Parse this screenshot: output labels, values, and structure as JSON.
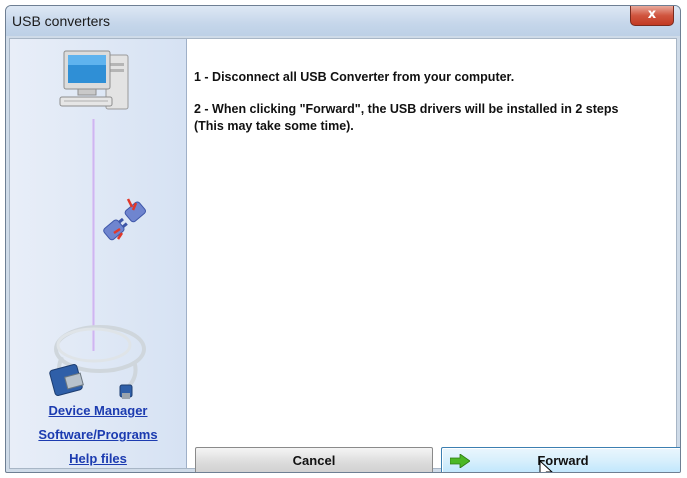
{
  "window": {
    "title": "USB converters",
    "close_symbol": "x"
  },
  "instructions": {
    "step1": "1 - Disconnect all USB Converter from your computer.",
    "step2_line1": "2 - When clicking \"Forward\", the USB drivers will be installed in 2 steps",
    "step2_line2": "(This may take some time)."
  },
  "sidebar": {
    "links": {
      "device_manager": "Device Manager",
      "software_programs": "Software/Programs",
      "help_files": "Help files"
    },
    "icons": [
      "computer-icon",
      "disconnected-plug-icon",
      "usb-serial-cable-icon"
    ]
  },
  "buttons": {
    "cancel": "Cancel",
    "forward": "Forward"
  },
  "colors": {
    "link": "#1c3bb0",
    "forward_button_border": "#3c7fb1",
    "arrow_green": "#4cb825"
  }
}
